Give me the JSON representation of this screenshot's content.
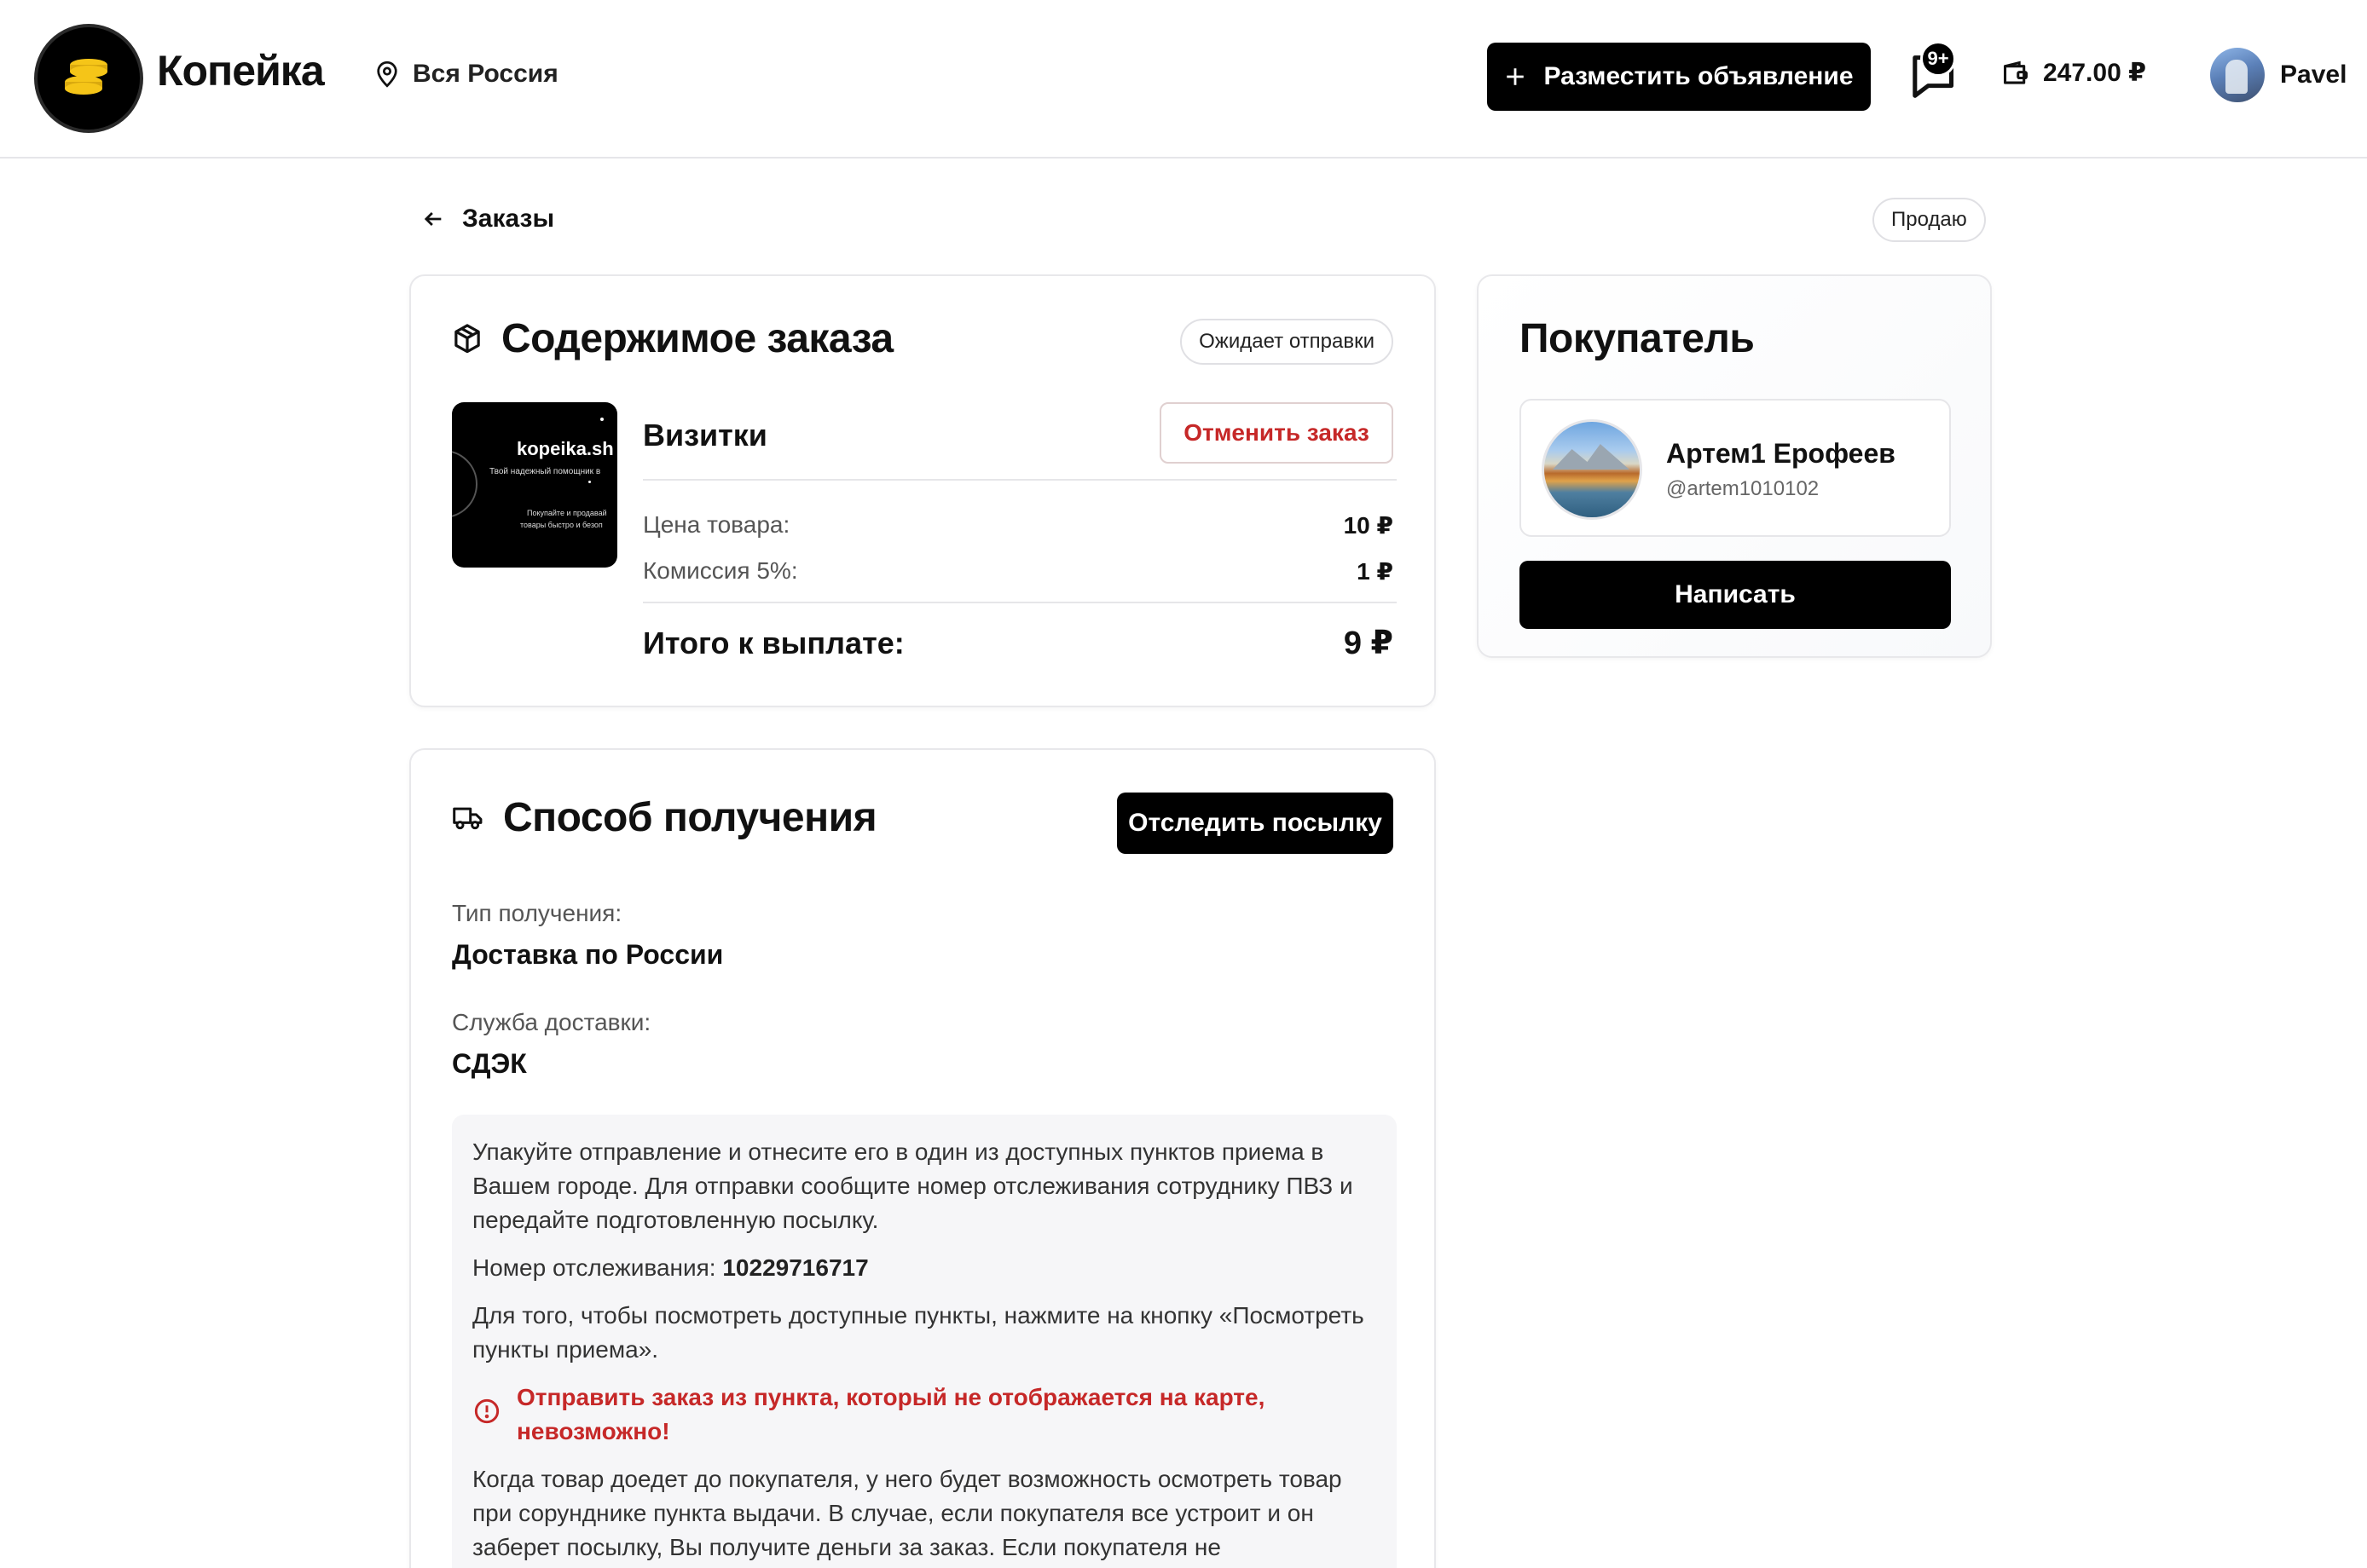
{
  "header": {
    "brand": "Копейка",
    "region": "Вся Россия",
    "post_button": "Разместить объявление",
    "chat_badge": "9+",
    "balance": "247.00 ₽",
    "user_name": "Pavel"
  },
  "topbar": {
    "back_label": "Заказы",
    "role": "Продаю"
  },
  "order": {
    "title": "Содержимое заказа",
    "status": "Ожидает отправки",
    "thumb": {
      "site": "kopeika.sh",
      "tagline": "Твой надежный помощник в",
      "line1": "Покупайте и продавай",
      "line2": "товары быстро и безоп"
    },
    "item_name": "Визитки",
    "cancel_button": "Отменить заказ",
    "price_label": "Цена товара:",
    "price_value": "10 ₽",
    "fee_label": "Комиссия 5%:",
    "fee_value": "1 ₽",
    "total_label": "Итого к выплате:",
    "total_value": "9 ₽"
  },
  "buyer": {
    "title": "Покупатель",
    "name": "Артем1 Ерофеев",
    "handle": "@artem1010102",
    "write_button": "Написать"
  },
  "delivery": {
    "title": "Способ получения",
    "track_button": "Отследить посылку",
    "type_label": "Тип получения:",
    "type_value": "Доставка по России",
    "service_label": "Служба доставки:",
    "service_value": "СДЭК",
    "info_p1": "Упакуйте отправление и отнесите его в один из доступных пунктов приема в Вашем городе. Для отправки сообщите номер отслеживания сотруднику ПВЗ и передайте подготовленную посылку.",
    "tracking_label": "Номер отслеживания:",
    "tracking_number": "10229716717",
    "info_p2": "Для того, чтобы посмотреть доступные пункты, нажмите на кнопку «Посмотреть пункты приема».",
    "warning": "Отправить заказ из пункта, который не отображается на карте, невозможно!",
    "info_p3": "Когда товар доедет до покупателя, у него будет возможность осмотреть товар при сорунднике пункта выдачи. В случае, если покупателя все устроит и он заберет посылку, Вы получите деньги за заказ. Если покупателя не"
  },
  "colors": {
    "accent": "#000000",
    "danger": "#c62828",
    "coin": "#f5c518"
  }
}
